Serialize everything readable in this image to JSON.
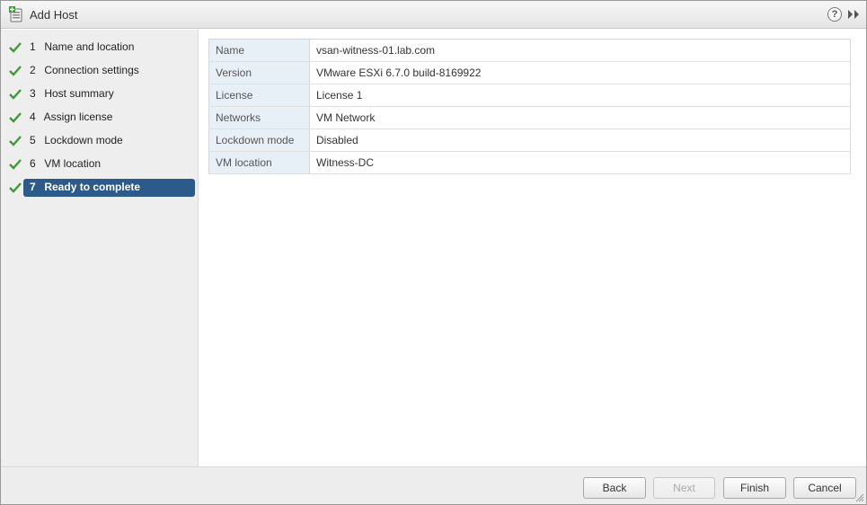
{
  "window": {
    "title": "Add Host",
    "help_glyph": "?"
  },
  "steps": [
    {
      "number": "1",
      "label": "Name and location",
      "completed": true,
      "active": false
    },
    {
      "number": "2",
      "label": "Connection settings",
      "completed": true,
      "active": false
    },
    {
      "number": "3",
      "label": "Host summary",
      "completed": true,
      "active": false
    },
    {
      "number": "4",
      "label": "Assign license",
      "completed": true,
      "active": false
    },
    {
      "number": "5",
      "label": "Lockdown mode",
      "completed": true,
      "active": false
    },
    {
      "number": "6",
      "label": "VM location",
      "completed": true,
      "active": false
    },
    {
      "number": "7",
      "label": "Ready to complete",
      "completed": true,
      "active": true
    }
  ],
  "summary": [
    {
      "key": "Name",
      "value": "vsan-witness-01.lab.com"
    },
    {
      "key": "Version",
      "value": "VMware ESXi 6.7.0 build-8169922"
    },
    {
      "key": "License",
      "value": "License 1"
    },
    {
      "key": "Networks",
      "value": "VM Network"
    },
    {
      "key": "Lockdown mode",
      "value": "Disabled"
    },
    {
      "key": "VM location",
      "value": "Witness-DC"
    }
  ],
  "buttons": {
    "back": "Back",
    "next": "Next",
    "finish": "Finish",
    "cancel": "Cancel"
  },
  "colors": {
    "active_step": "#2b5a8b",
    "check": "#3d9a37",
    "key_cell": "#e8f0f7"
  },
  "icons": {
    "title": "add-host-icon",
    "help": "help-icon",
    "expand": "double-chevron-right-icon",
    "step_done": "checkmark-icon"
  }
}
